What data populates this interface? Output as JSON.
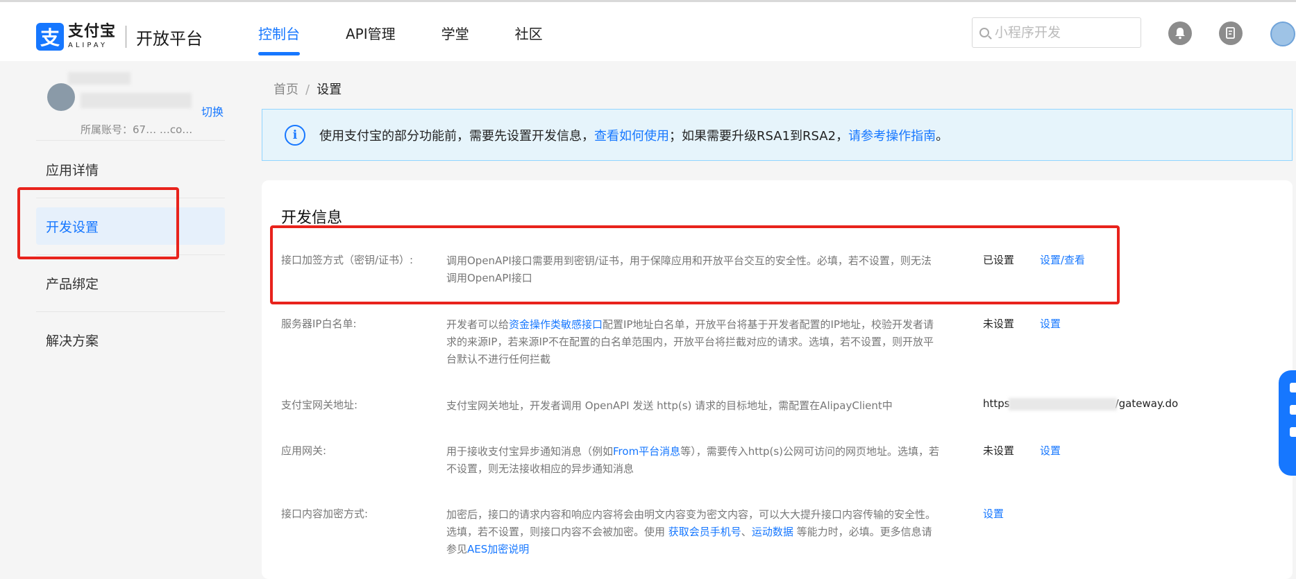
{
  "header": {
    "logo_mark": "支",
    "logo_cn": "支付宝",
    "logo_en": "ALIPAY",
    "platform": "开放平台",
    "nav": [
      {
        "label": "控制台",
        "active": true
      },
      {
        "label": "API管理",
        "active": false
      },
      {
        "label": "学堂",
        "active": false
      },
      {
        "label": "社区",
        "active": false
      }
    ],
    "search_placeholder": "小程序开发",
    "icons": [
      "bell-icon",
      "document-icon",
      "user-avatar"
    ]
  },
  "sidebar": {
    "switch_label": "切换",
    "account_line": "所属账号：67…  …co…",
    "items": [
      {
        "label": "应用详情",
        "active": false
      },
      {
        "label": "开发设置",
        "active": true
      },
      {
        "label": "产品绑定",
        "active": false
      },
      {
        "label": "解决方案",
        "active": false
      }
    ]
  },
  "breadcrumb": {
    "home": "首页",
    "separator": "/",
    "current": "设置"
  },
  "notice": {
    "text_1": "使用支付宝的部分功能前，需要先设置开发信息，",
    "link_1": "查看如何使用",
    "text_2": "；如果需要升级RSA1到RSA2，",
    "link_2": "请参考操作指南",
    "text_3": "。"
  },
  "dev_info": {
    "title": "开发信息",
    "rows": [
      {
        "label": "接口加签方式（密钥/证书）:",
        "desc": "调用OpenAPI接口需要用到密钥/证书，用于保障应用和开放平台交互的安全性。必填，若不设置，则无法调用OpenAPI接口",
        "status": "已设置",
        "action": "设置/查看"
      },
      {
        "label": "服务器IP白名单:",
        "desc_1": "开发者可以给",
        "desc_link": "资金操作类敏感接口",
        "desc_2": "配置IP地址白名单，开放平台将基于开发者配置的IP地址，校验开发者请求的来源IP，若来源IP不在配置的白名单范围内，开放平台将拦截对应的请求。选填，若不设置，则开放平台默认不进行任何拦截",
        "status": "未设置",
        "action": "设置"
      },
      {
        "label": "支付宝网关地址:",
        "desc": "支付宝网关地址，开发者调用 OpenAPI 发送 http(s) 请求的目标地址，需配置在AlipayClient中",
        "gateway_prefix": "https",
        "gateway_suffix": "/gateway.do"
      },
      {
        "label": "应用网关:",
        "desc_1": "用于接收支付宝异步通知消息（例如",
        "desc_link": "From平台消息",
        "desc_2": "等），需要传入http(s)公网可访问的网页地址。选填，若不设置，则无法接收相应的异步通知消息",
        "status": "未设置",
        "action": "设置"
      },
      {
        "label": "接口内容加密方式:",
        "desc_1": "加密后，接口的请求内容和响应内容将会由明文内容变为密文内容，可以大大提升接口内容传输的安全性。选填，若不设置，则接口内容不会被加密。使用 ",
        "desc_link_1": "获取会员手机号",
        "desc_sep": "、",
        "desc_link_2": "运动数据",
        "desc_2": " 等能力时，必填。更多信息请参见",
        "desc_link_3": "AES加密说明",
        "action": "设置"
      }
    ]
  },
  "colors": {
    "brand": "#1677ff",
    "annotation": "#e8231c",
    "notice_bg": "#e6f4fb"
  }
}
